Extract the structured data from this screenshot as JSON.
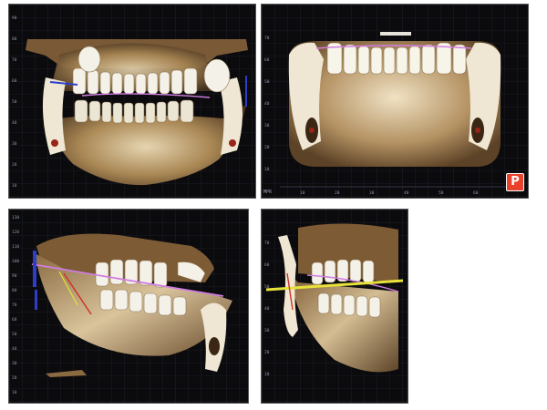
{
  "views": {
    "frontal": {
      "ruler_ticks": [
        "90",
        "80",
        "70",
        "60",
        "50",
        "40",
        "30",
        "20",
        "10"
      ]
    },
    "axial": {
      "ruler_ticks": [
        "70",
        "60",
        "50",
        "40",
        "30",
        "20",
        "10"
      ],
      "bottom_ticks": [
        "10",
        "20",
        "30",
        "40",
        "50",
        "60"
      ],
      "corner_label": "MPR",
      "badge_label": "P",
      "badge_color": "#e8412c"
    },
    "lateral_left": {
      "ruler_ticks": [
        "130",
        "120",
        "110",
        "100",
        "90",
        "80",
        "70",
        "60",
        "50",
        "40",
        "30",
        "20",
        "10"
      ]
    },
    "lateral_right": {
      "ruler_ticks": [
        "70",
        "60",
        "50",
        "40",
        "30",
        "20",
        "10"
      ]
    }
  },
  "colors": {
    "background": "#0b0b0d",
    "grid": "#2a2f45",
    "bone": "#c9b28a",
    "enamel": "#f4f1e8",
    "occlusal_line": "#d07de0",
    "marker_blue": "#2d3fc9",
    "plane_yellow": "#e8e23a",
    "plane_red": "#d0322a"
  }
}
